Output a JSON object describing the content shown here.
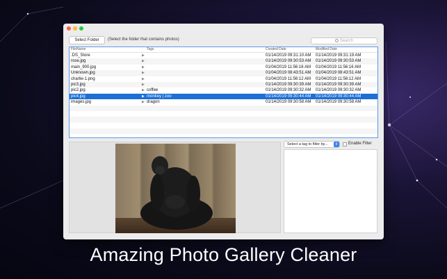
{
  "toolbar": {
    "select_folder_label": "Select Folder",
    "hint": "(Select the folder that contains photos)",
    "search_placeholder": "Search"
  },
  "table": {
    "headers": [
      "FileName",
      "Tags",
      "Created Date",
      "Modified Date"
    ],
    "rows": [
      {
        "file": ".DS_Store",
        "tags": "",
        "created": "01/14/2019 09:31:10 AM",
        "modified": "01/14/2019 09:31:19 AM"
      },
      {
        "file": "rose.jpg",
        "tags": "",
        "created": "01/14/2019 09:30:53 AM",
        "modified": "01/14/2019 09:30:53 AM"
      },
      {
        "file": "main_900.jpg",
        "tags": "",
        "created": "01/04/2019 11:56:16 AM",
        "modified": "01/04/2019 11:56:16 AM"
      },
      {
        "file": "Unknown.jpg",
        "tags": "",
        "created": "01/04/2019 08:43:51 AM",
        "modified": "01/04/2019 08:43:51 AM"
      },
      {
        "file": "charlie-1.png",
        "tags": "",
        "created": "01/04/2019 11:56:12 AM",
        "modified": "01/04/2019 11:56:12 AM"
      },
      {
        "file": "pic3.jpg",
        "tags": "",
        "created": "01/14/2019 09:30:39 AM",
        "modified": "01/14/2019 09:30:39 AM"
      },
      {
        "file": "pic2.jpg",
        "tags": "coffee",
        "created": "01/14/2019 09:30:32 AM",
        "modified": "01/14/2019 09:30:32 AM"
      },
      {
        "file": "pic4.jpg",
        "tags": "monkey | zoo",
        "created": "01/14/2019 09:30:44 AM",
        "modified": "01/14/2019 09:30:44 AM"
      },
      {
        "file": "images.jpg",
        "tags": "dragon",
        "created": "01/14/2019 09:30:58 AM",
        "modified": "01/14/2019 09:30:58 AM"
      }
    ],
    "selected_index": 7,
    "arrow_glyph": "▶"
  },
  "filter": {
    "select_placeholder": "Select a tag to filter by...",
    "enable_label": "Enable Filter"
  },
  "caption": "Amazing Photo Gallery Cleaner",
  "colors": {
    "selection": "#1d6fd6",
    "table_border": "#5b9ae9",
    "close": "#fc5f57",
    "minimize": "#fdbc2e",
    "maximize": "#28c840"
  }
}
